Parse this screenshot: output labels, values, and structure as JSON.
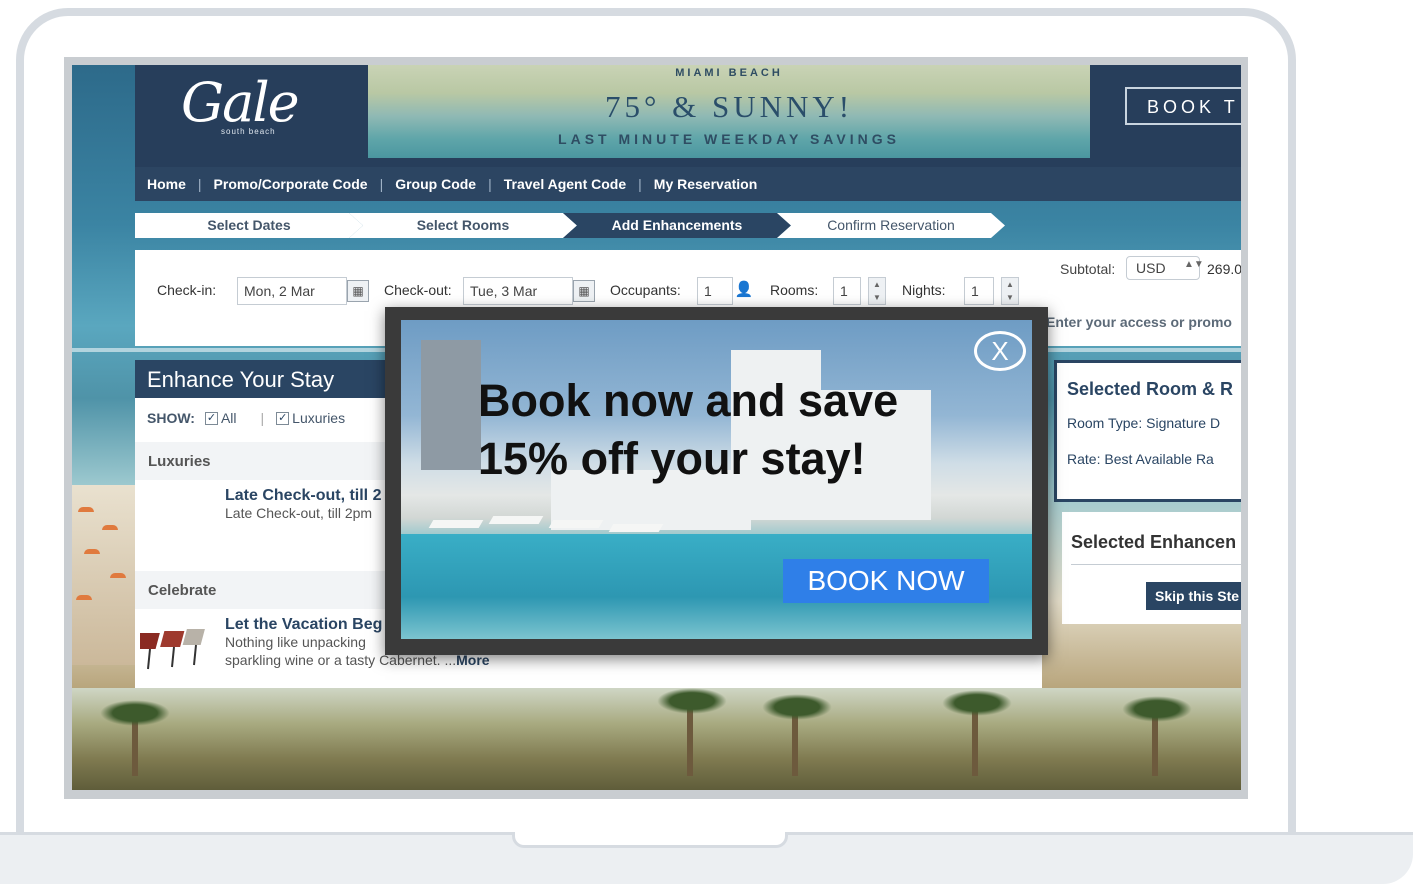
{
  "header": {
    "logo_text": "Gale",
    "logo_sub": "south beach",
    "banner_top": "MIAMI BEACH",
    "banner_main": "75° & SUNNY!",
    "banner_bottom": "LAST MINUTE WEEKDAY SAVINGS",
    "book_button": "BOOK T"
  },
  "nav": {
    "items": [
      "Home",
      "Promo/Corporate Code",
      "Group Code",
      "Travel Agent Code",
      "My Reservation"
    ],
    "separator": "|"
  },
  "steps": [
    "Select Dates",
    "Select Rooms",
    "Add Enhancements",
    "Confirm Reservation"
  ],
  "form": {
    "checkin_label": "Check-in:",
    "checkin_value": "Mon, 2 Mar",
    "checkout_label": "Check-out:",
    "checkout_value": "Tue, 3 Mar",
    "occupants_label": "Occupants:",
    "occupants_value": "1",
    "rooms_label": "Rooms:",
    "rooms_value": "1",
    "nights_label": "Nights:",
    "nights_value": "1"
  },
  "summary": {
    "subtotal_label": "Subtotal:",
    "currency": "USD",
    "amount": "269.0",
    "promo_text": "Enter your access or promo",
    "room_title": "Selected Room & R",
    "room_type_label": "Room Type:",
    "room_type_value": "Signature D",
    "rate_label": "Rate:",
    "rate_value": "Best Available Ra",
    "enh_title": "Selected Enhancen",
    "skip_button": "Skip this Ste"
  },
  "enhance": {
    "heading": "Enhance Your Stay",
    "show_label": "SHOW:",
    "filter_all": "All",
    "filter_luxuries": "Luxuries",
    "categories": [
      {
        "name": "Luxuries",
        "item_title": "Late Check-out, till 2",
        "item_desc": "Late Check-out, till 2pm"
      },
      {
        "name": "Celebrate",
        "item_title": "Let the Vacation Beg",
        "item_desc_1": "Nothing like unpacking",
        "item_desc_2": "sparkling wine or a tasty Cabernet. ...",
        "item_more": "More"
      }
    ]
  },
  "modal": {
    "headline_1": "Book now and save",
    "headline_2": "15% off your stay!",
    "cta": "BOOK NOW",
    "close": "X"
  }
}
